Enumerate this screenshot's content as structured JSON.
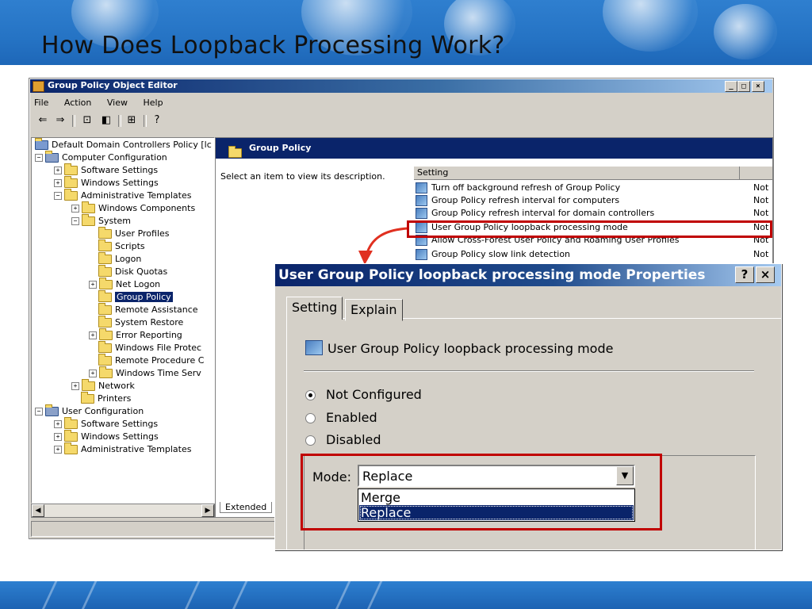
{
  "slide": {
    "title": "How Does Loopback Processing Work?"
  },
  "gpo_window": {
    "title": "Group Policy Object Editor",
    "menu": [
      "File",
      "Action",
      "View",
      "Help"
    ],
    "tree": [
      {
        "label": "Default Domain Controllers Policy [lc"
      },
      {
        "label": "Computer Configuration"
      },
      {
        "label": "Software Settings"
      },
      {
        "label": "Windows Settings"
      },
      {
        "label": "Administrative Templates"
      },
      {
        "label": "Windows Components"
      },
      {
        "label": "System"
      },
      {
        "label": "User Profiles"
      },
      {
        "label": "Scripts"
      },
      {
        "label": "Logon"
      },
      {
        "label": "Disk Quotas"
      },
      {
        "label": "Net Logon"
      },
      {
        "label": "Group Policy"
      },
      {
        "label": "Remote Assistance"
      },
      {
        "label": "System Restore"
      },
      {
        "label": "Error Reporting"
      },
      {
        "label": "Windows File Protec"
      },
      {
        "label": "Remote Procedure C"
      },
      {
        "label": "Windows Time Serv"
      },
      {
        "label": "Network"
      },
      {
        "label": "Printers"
      },
      {
        "label": "User Configuration"
      },
      {
        "label": "Software Settings"
      },
      {
        "label": "Windows Settings"
      },
      {
        "label": "Administrative Templates"
      }
    ],
    "right_header": "Group Policy",
    "description": "Select an item to view its description.",
    "list_header": "Setting",
    "settings": [
      {
        "name": "Turn off background refresh of Group Policy",
        "state": "Not"
      },
      {
        "name": "Group Policy refresh interval for computers",
        "state": "Not"
      },
      {
        "name": "Group Policy refresh interval for domain controllers",
        "state": "Not"
      },
      {
        "name": "User Group Policy loopback processing mode",
        "state": "Not"
      },
      {
        "name": "Allow Cross-Forest User Policy and Roaming User Profiles",
        "state": "Not"
      },
      {
        "name": "Group Policy slow link detection",
        "state": "Not"
      }
    ],
    "tab_label": "Extended"
  },
  "dialog": {
    "title": "User Group Policy loopback processing mode Properties",
    "help_btn": "?",
    "close_btn": "×",
    "tabs": [
      "Setting",
      "Explain"
    ],
    "policy_name": "User Group Policy loopback processing mode",
    "options": {
      "not_configured": "Not Configured",
      "enabled": "Enabled",
      "disabled": "Disabled"
    },
    "mode_label": "Mode:",
    "mode_value": "Replace",
    "mode_options": [
      "Merge",
      "Replace"
    ]
  },
  "colors": {
    "highlight": "#c00000",
    "titlebar": "#0a246a"
  }
}
